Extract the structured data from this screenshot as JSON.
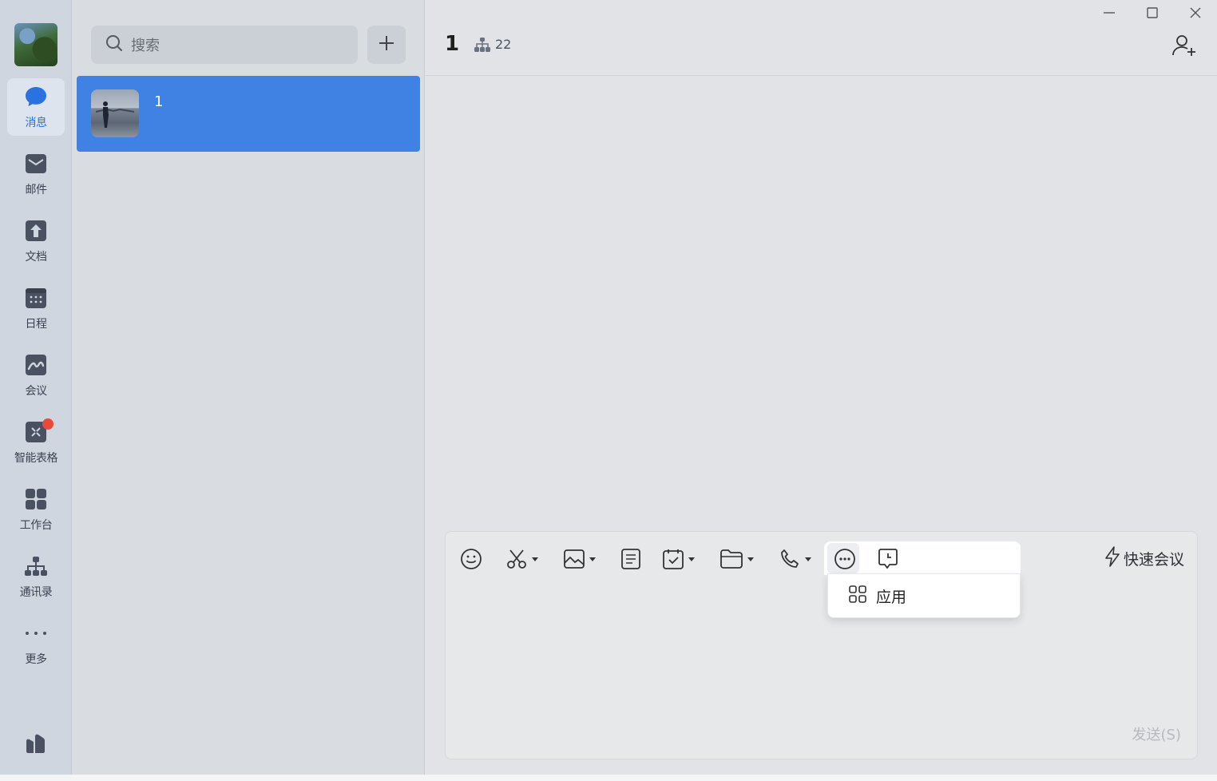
{
  "nav": {
    "items": [
      {
        "label": "消息",
        "icon": "chat-bubble-icon",
        "active": true
      },
      {
        "label": "邮件",
        "icon": "mail-icon"
      },
      {
        "label": "文档",
        "icon": "document-icon"
      },
      {
        "label": "日程",
        "icon": "calendar-icon"
      },
      {
        "label": "会议",
        "icon": "meeting-icon"
      },
      {
        "label": "智能表格",
        "icon": "smart-sheet-icon",
        "badge": true
      },
      {
        "label": "工作台",
        "icon": "workbench-icon"
      },
      {
        "label": "通讯录",
        "icon": "contacts-icon"
      },
      {
        "label": "更多",
        "icon": "more-dots-icon"
      }
    ],
    "accent": "#2a72e0",
    "badge_color": "#e84a3a"
  },
  "list": {
    "search_placeholder": "搜索",
    "conversations": [
      {
        "title": "1",
        "selected": true
      }
    ],
    "selected_color": "#3f82e4"
  },
  "chat": {
    "title": "1",
    "member_count": "22",
    "composer": {
      "tools": [
        "emoji-icon",
        "scissors-icon",
        "image-icon",
        "note-icon",
        "todo-icon",
        "folder-icon",
        "phone-icon",
        "more-circle-icon",
        "comment-clock-icon"
      ],
      "popup_item": "应用",
      "quick_meeting": "快速会议",
      "send": "发送(S)"
    }
  }
}
